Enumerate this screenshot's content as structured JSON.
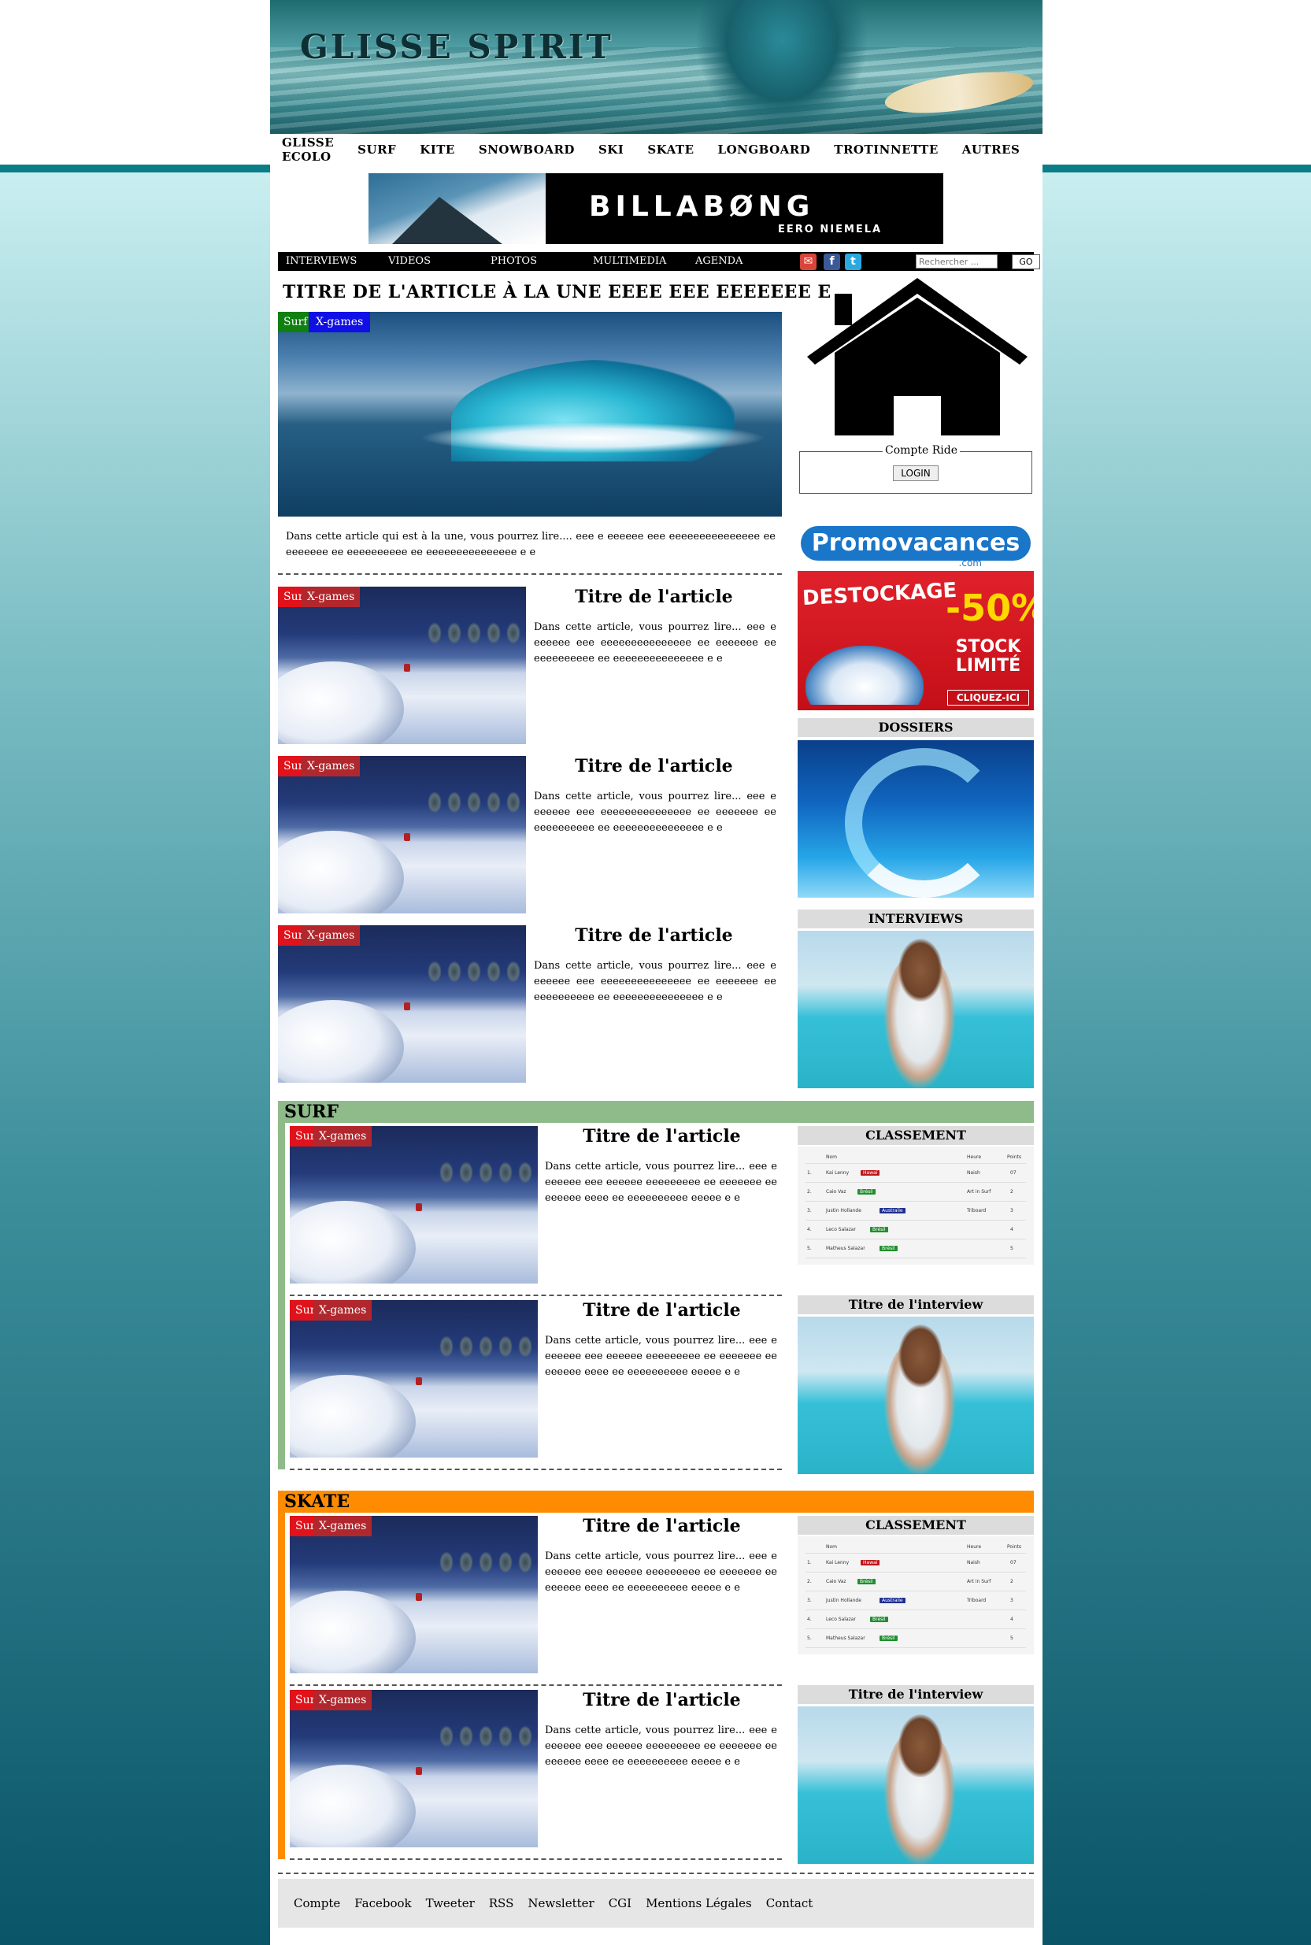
{
  "site": {
    "logo": "GLISSE SPIRIT"
  },
  "top_nav": [
    "GLISSE ECOLO",
    "SURF",
    "KITE",
    "SNOWBOARD",
    "SKI",
    "SKATE",
    "LONGBOARD",
    "TROTINNETTE",
    "AUTRES"
  ],
  "ad_top": {
    "brand": "BILLABØNG",
    "sub": "EERO NIEMELA"
  },
  "sub_nav": [
    "INTERVIEWS",
    "VIDEOS",
    "PHOTOS",
    "MULTIMEDIA",
    "AGENDA"
  ],
  "search": {
    "placeholder": "Rechercher ...",
    "button": "GO"
  },
  "social_icons": [
    "mail-icon",
    "facebook-icon",
    "twitter-icon"
  ],
  "headline": {
    "title": "TITRE DE L'ARTICLE À LA UNE EEEE EEE EEEEEEE E",
    "tags": [
      "Surf",
      "X-games"
    ],
    "text": "Dans cette article qui est à la une, vous pourrez lire.... eee e eeeeee eee eeeeeeeeeeeeeee ee eeeeeee ee eeeeeeeeee ee eeeeeeeeeeeeeee e e"
  },
  "articles": [
    {
      "title": "Titre de l'article",
      "tags": [
        "Surf",
        "X-games"
      ],
      "text": "Dans cette article, vous pourrez lire... eee e eeeeee eee eeeeeeeeeeeeeee ee eeeeeee ee eeeeeeeeee ee eeeeeeeeeeeeeee e e"
    },
    {
      "title": "Titre de l'article",
      "tags": [
        "Surf",
        "X-games"
      ],
      "text": "Dans cette article, vous pourrez lire... eee e eeeeee eee eeeeeeeeeeeeeee ee eeeeeee ee eeeeeeeeee ee eeeeeeeeeeeeeee e e"
    },
    {
      "title": "Titre de l'article",
      "tags": [
        "Surf",
        "X-games"
      ],
      "text": "Dans cette article, vous pourrez lire... eee e eeeeee eee eeeeeeeeeeeeeee ee eeeeeee ee eeeeeeeeee ee eeeeeeeeeeeeeee e e"
    }
  ],
  "sidebar": {
    "login_legend": "Compte Ride",
    "login_button": "LOGIN",
    "promo": {
      "logo": "Promovacances",
      "dotcom": ".com",
      "destockage": "DESTOCKAGE",
      "pct": "-50%",
      "stock": "STOCK LIMITÉ",
      "cta": "CLIQUEZ-ICI"
    },
    "dossiers": "DOSSIERS",
    "interviews": "INTERVIEWS"
  },
  "sections": [
    {
      "name": "SURF",
      "color": "#8fbb8a",
      "articles": [
        {
          "title": "Titre de l'article",
          "tags": [
            "Surf",
            "X-games"
          ],
          "text": "Dans cette article, vous pourrez lire... eee e eeeeee eee eeeeee eeeeeeeee ee eeeeeee ee eeeeee eeee ee eeeeeeeeee eeeee e e"
        },
        {
          "title": "Titre de l'article",
          "tags": [
            "Surf",
            "X-games"
          ],
          "text": "Dans cette article, vous pourrez lire... eee e eeeeee eee eeeeee eeeeeeeee ee eeeeeee ee eeeeee eeee ee eeeeeeeeee eeeee e e"
        }
      ],
      "classement": "CLASSEMENT",
      "interview": "Titre de l'interview"
    },
    {
      "name": "SKATE",
      "color": "#ff8c00",
      "articles": [
        {
          "title": "Titre de l'article",
          "tags": [
            "Surf",
            "X-games"
          ],
          "text": "Dans cette article, vous pourrez lire... eee e eeeeee eee eeeeee eeeeeeeee ee eeeeeee ee eeeeee eeee ee eeeeeeeeee eeeee e e"
        },
        {
          "title": "Titre de l'article",
          "tags": [
            "Surf",
            "X-games"
          ],
          "text": "Dans cette article, vous pourrez lire... eee e eeeeee eee eeeeee eeeeeeeee ee eeeeeee ee eeeeee eeee ee eeeeeeeeee eeeee e e"
        }
      ],
      "classement": "CLASSEMENT",
      "interview": "Titre de l'interview"
    }
  ],
  "ranking": {
    "headers": [
      "Nom",
      "Heure",
      "Points"
    ],
    "rows": [
      {
        "pos": "1.",
        "name": "Kai Lenny",
        "badge": "Hawaï",
        "badge_color": "#c0161d",
        "time": "Naish",
        "pts": "07"
      },
      {
        "pos": "2.",
        "name": "Caio Vaz",
        "badge": "Brésil",
        "badge_color": "#1f8f2e",
        "time": "Art in Surf",
        "pts": "2"
      },
      {
        "pos": "3.",
        "name": "Justin Hollande",
        "badge": "Australie",
        "badge_color": "#1f2f8f",
        "time": "Triboard",
        "pts": "3"
      },
      {
        "pos": "4.",
        "name": "Leco Salazar",
        "badge": "Brésil",
        "badge_color": "#1f8f2e",
        "time": "",
        "pts": "4"
      },
      {
        "pos": "5.",
        "name": "Matheus Salazar",
        "badge": "Brésil",
        "badge_color": "#1f8f2e",
        "time": "",
        "pts": "5"
      }
    ]
  },
  "tag_colors": {
    "surf": "#e0121b",
    "xgames_blue": "#1010e6",
    "xgames_red": "#b0282e",
    "surf_green": "#108010"
  },
  "footer": [
    "Compte",
    "Facebook",
    "Tweeter",
    "RSS",
    "Newsletter",
    "CGI",
    "Mentions Légales",
    "Contact"
  ]
}
